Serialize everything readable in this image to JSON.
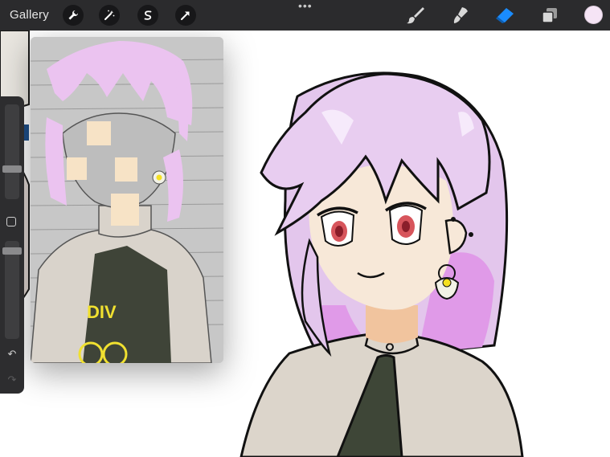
{
  "topbar": {
    "gallery_label": "Gallery",
    "left_tools": [
      "wrench-icon",
      "magic-wand-icon",
      "selection-icon",
      "transform-arrow-icon"
    ],
    "more_label": "•••",
    "right_tools": [
      "brush-icon",
      "smudge-icon",
      "eraser-icon",
      "layers-icon"
    ],
    "active_tool": "eraser",
    "current_color": "#f5e4f5",
    "accent_color": "#1a8cff"
  },
  "reference_window": {
    "visible_text": "DIV"
  },
  "sidebar": {
    "brush_size_level": 0.45,
    "opacity_level": 0.1,
    "undo_label": "↶",
    "redo_label": "↷"
  }
}
